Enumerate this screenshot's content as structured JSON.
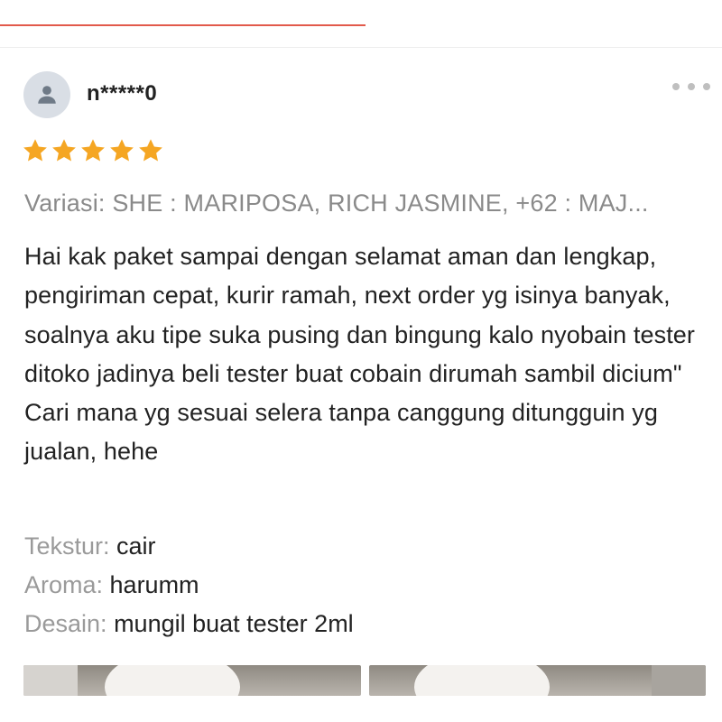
{
  "colors": {
    "accent_line": "#e25a4b",
    "star": "#f5a623",
    "label_gray": "#9a9a9a",
    "text": "#222222"
  },
  "review": {
    "user": {
      "avatar_icon": "user-icon",
      "name": "n*****0"
    },
    "more_icon": "more-dots-icon",
    "rating": 5,
    "variation": "Variasi: SHE : MARIPOSA, RICH JASMINE, +62 : MAJ...",
    "text": "Hai kak paket sampai dengan selamat aman dan lengkap, pengiriman cepat, kurir ramah, next order yg isinya banyak, soalnya aku tipe suka pusing dan bingung kalo nyobain tester ditoko jadinya beli tester buat cobain dirumah sambil dicium\" Cari mana yg sesuai selera tanpa canggung ditungguin yg jualan, hehe",
    "attributes": [
      {
        "label": "Tekstur: ",
        "value": "cair"
      },
      {
        "label": "Aroma: ",
        "value": "harumm"
      },
      {
        "label": "Desain: ",
        "value": "mungil buat tester 2ml"
      }
    ]
  }
}
